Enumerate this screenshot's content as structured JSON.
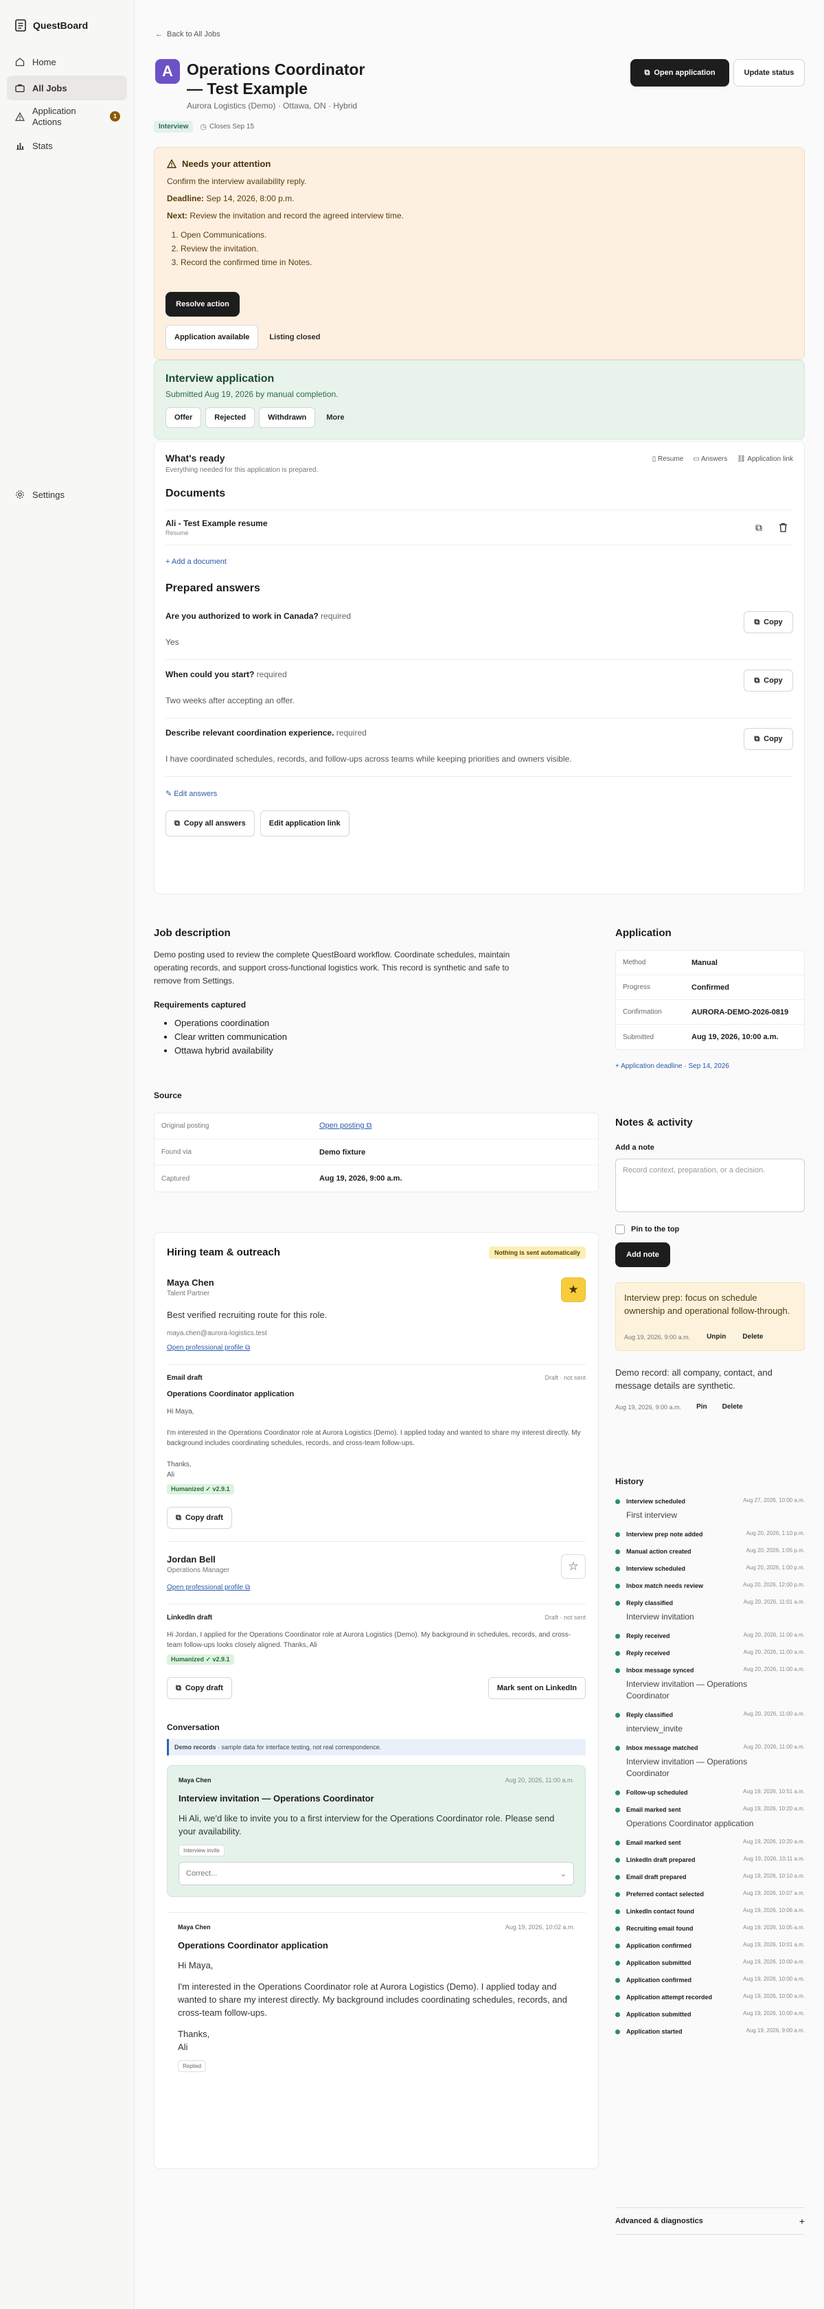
{
  "app": {
    "name": "QuestBoard"
  },
  "sidebar": {
    "items": [
      {
        "label": "Home",
        "icon": "home-icon"
      },
      {
        "label": "All Jobs",
        "icon": "briefcase-icon"
      },
      {
        "label": "Application Actions",
        "icon": "alert-icon",
        "badge": "1"
      },
      {
        "label": "Stats",
        "icon": "bar-chart-icon"
      }
    ],
    "settings": "Settings"
  },
  "header": {
    "back": "Back to All Jobs",
    "logo_letter": "A",
    "title": "Operations Coordinator — Test Example",
    "company": "Aurora Logistics (Demo) · Ottawa, ON · Hybrid",
    "stage": "Interview",
    "closes": "Closes Sep 15",
    "open_button": "Open application",
    "status_button": "Update status"
  },
  "attention": {
    "title": "Needs your attention",
    "line1": "Confirm the interview availability reply.",
    "deadline_label": "Deadline:",
    "deadline": "Sep 14, 2026, 8:00 p.m.",
    "next_label": "Next:",
    "next": "Review the invitation and record the agreed interview time.",
    "steps": [
      "Open Communications.",
      "Review the invitation.",
      "Record the confirmed time in Notes."
    ],
    "resolve": "Resolve action",
    "tag1": "Application available",
    "tag2": "Listing closed"
  },
  "interview_app": {
    "title": "Interview application",
    "subtitle": "Submitted Aug 19, 2026 by manual completion.",
    "actions": [
      "Offer",
      "Rejected",
      "Withdrawn",
      "More"
    ]
  },
  "ready": {
    "title": "What's ready",
    "subtitle": "Everything needed for this application is prepared.",
    "links": [
      "Resume",
      "Answers",
      "Application link"
    ],
    "documents_title": "Documents",
    "document": {
      "name": "Ali - Test Example resume",
      "kind": "Resume"
    },
    "add_document": "+ Add a document",
    "answers_title": "Prepared answers",
    "questions": [
      {
        "q": "Are you authorized to work in Canada?",
        "req": "required",
        "a": "Yes"
      },
      {
        "q": "When could you start?",
        "req": "required",
        "a": "Two weeks after accepting an offer."
      },
      {
        "q": "Describe relevant coordination experience.",
        "req": "required",
        "a": "I have coordinated schedules, records, and follow-ups across teams while keeping priorities and owners visible."
      }
    ],
    "copy": "Copy",
    "edit_answers": "✎ Edit answers",
    "copy_all": "Copy all answers",
    "edit_link": "Edit application link"
  },
  "job": {
    "title": "Job description",
    "text": "Demo posting used to review the complete QuestBoard workflow. Coordinate schedules, maintain operating records, and support cross-functional logistics work. This record is synthetic and safe to remove from Settings.",
    "req_title": "Requirements captured",
    "reqs": [
      "Operations coordination",
      "Clear written communication",
      "Ottawa hybrid availability"
    ]
  },
  "source": {
    "title": "Source",
    "rows": [
      {
        "k": "Original posting",
        "v": "Open posting"
      },
      {
        "k": "Found via",
        "v": "Demo fixture"
      },
      {
        "k": "Captured",
        "v": "Aug 19, 2026, 9:00 a.m."
      }
    ]
  },
  "application": {
    "title": "Application",
    "rows": [
      {
        "k": "Method",
        "v": "Manual"
      },
      {
        "k": "Progress",
        "v": "Confirmed"
      },
      {
        "k": "Confirmation",
        "v": "AURORA-DEMO-2026-0819"
      },
      {
        "k": "Submitted",
        "v": "Aug 19, 2026, 10:00 a.m."
      }
    ],
    "deadline_link": "+ Application deadline · Sep 14, 2026"
  },
  "hiring": {
    "title": "Hiring team & outreach",
    "badge": "Nothing is sent automatically",
    "contact1": {
      "name": "Maya Chen",
      "role": "Talent Partner",
      "note": "Best verified recruiting route for this role.",
      "email": "maya.chen@aurora-logistics.test",
      "profile": "Open professional profile"
    },
    "email_draft": {
      "label": "Email draft",
      "status": "Draft · not sent",
      "subject": "Operations Coordinator application",
      "greeting": "Hi Maya,",
      "body": "I'm interested in the Operations Coordinator role at Aurora Logistics (Demo). I applied today and wanted to share my interest directly. My background includes coordinating schedules, records, and cross-team follow-ups.",
      "signoff": "Thanks,",
      "name": "Ali",
      "humanized": "Humanized ✓ v2.9.1",
      "copy": "Copy draft"
    },
    "contact2": {
      "name": "Jordan Bell",
      "role": "Operations Manager",
      "profile": "Open professional profile"
    },
    "linkedin_draft": {
      "label": "LinkedIn draft",
      "status": "Draft · not sent",
      "body": "Hi Jordan, I applied for the Operations Coordinator role at Aurora Logistics (Demo). My background in schedules, records, and cross-team follow-ups looks closely aligned. Thanks, Ali",
      "humanized": "Humanized ✓ v2.9.1",
      "copy": "Copy draft",
      "mark": "Mark sent on LinkedIn"
    },
    "conversation": {
      "title": "Conversation",
      "demo_label": "Demo records",
      "demo_text": " · sample data for interface testing, not real correspondence.",
      "msg1": {
        "from": "Maya Chen",
        "time": "Aug 20, 2026, 11:00 a.m.",
        "subject": "Interview invitation — Operations Coordinator",
        "body": "Hi Ali, we'd like to invite you to a first interview for the Operations Coordinator role. Please send your availability.",
        "tag": "Interview invite",
        "select": "Correct..."
      },
      "msg2": {
        "from": "Operations Coordinator application",
        "sender": "Maya Chen",
        "time": "Aug 19, 2026, 10:02 a.m.",
        "greeting": "Hi Maya,",
        "body": "I'm interested in the Operations Coordinator role at Aurora Logistics (Demo). I applied today and wanted to share my interest directly. My background includes coordinating schedules, records, and cross-team follow-ups.",
        "signoff": "Thanks,",
        "name": "Ali",
        "tag": "Replied"
      }
    }
  },
  "notes": {
    "title": "Notes & activity",
    "add_label": "Add a note",
    "placeholder": "Record context, preparation, or a decision.",
    "pin_label": "Pin to the top",
    "add_button": "Add note",
    "pinned": {
      "text": "Interview prep: focus on schedule ownership and operational follow-through.",
      "time": "Aug 19, 2026, 9:00 a.m.",
      "unpin": "Unpin",
      "delete": "Delete"
    },
    "record": {
      "text": "Demo record: all company, contact, and message details are synthetic.",
      "time": "Aug 19, 2026, 9:00 a.m.",
      "pin": "Pin",
      "delete": "Delete"
    }
  },
  "history": {
    "title": "History",
    "items": [
      {
        "e": "Interview scheduled",
        "t": "Aug 27, 2026, 10:00 a.m.",
        "s": "First interview"
      },
      {
        "e": "Interview prep note added",
        "t": "Aug 20, 2026, 1:10 p.m.",
        "s": ""
      },
      {
        "e": "Manual action created",
        "t": "Aug 20, 2026, 1:05 p.m.",
        "s": ""
      },
      {
        "e": "Interview scheduled",
        "t": "Aug 20, 2026, 1:00 p.m.",
        "s": ""
      },
      {
        "e": "Inbox match needs review",
        "t": "Aug 20, 2026, 12:00 p.m.",
        "s": ""
      },
      {
        "e": "Reply classified",
        "t": "Aug 20, 2026, 11:01 a.m.",
        "s": "Interview invitation"
      },
      {
        "e": "Reply received",
        "t": "Aug 20, 2026, 11:00 a.m.",
        "s": ""
      },
      {
        "e": "Reply received",
        "t": "Aug 20, 2026, 11:00 a.m.",
        "s": ""
      },
      {
        "e": "Inbox message synced",
        "t": "Aug 20, 2026, 11:00 a.m.",
        "s": "Interview invitation — Operations Coordinator"
      },
      {
        "e": "Reply classified",
        "t": "Aug 20, 2026, 11:00 a.m.",
        "s": "interview_invite"
      },
      {
        "e": "Inbox message matched",
        "t": "Aug 20, 2026, 11:00 a.m.",
        "s": "Interview invitation — Operations Coordinator"
      },
      {
        "e": "Follow-up scheduled",
        "t": "Aug 19, 2026, 10:51 a.m.",
        "s": ""
      },
      {
        "e": "Email marked sent",
        "t": "Aug 19, 2026, 10:20 a.m.",
        "s": "Operations Coordinator application"
      },
      {
        "e": "Email marked sent",
        "t": "Aug 19, 2026, 10:20 a.m.",
        "s": ""
      },
      {
        "e": "LinkedIn draft prepared",
        "t": "Aug 19, 2026, 10:11 a.m.",
        "s": ""
      },
      {
        "e": "Email draft prepared",
        "t": "Aug 19, 2026, 10:10 a.m.",
        "s": ""
      },
      {
        "e": "Preferred contact selected",
        "t": "Aug 19, 2026, 10:07 a.m.",
        "s": ""
      },
      {
        "e": "LinkedIn contact found",
        "t": "Aug 19, 2026, 10:06 a.m.",
        "s": ""
      },
      {
        "e": "Recruiting email found",
        "t": "Aug 19, 2026, 10:05 a.m.",
        "s": ""
      },
      {
        "e": "Application confirmed",
        "t": "Aug 19, 2026, 10:01 a.m.",
        "s": ""
      },
      {
        "e": "Application submitted",
        "t": "Aug 19, 2026, 10:00 a.m.",
        "s": ""
      },
      {
        "e": "Application confirmed",
        "t": "Aug 19, 2026, 10:00 a.m.",
        "s": ""
      },
      {
        "e": "Application attempt recorded",
        "t": "Aug 19, 2026, 10:00 a.m.",
        "s": ""
      },
      {
        "e": "Application submitted",
        "t": "Aug 19, 2026, 10:00 a.m.",
        "s": ""
      },
      {
        "e": "Application started",
        "t": "Aug 19, 2026, 9:00 a.m.",
        "s": ""
      }
    ]
  },
  "advanced": {
    "label": "Advanced & diagnostics",
    "icon": "+"
  },
  "colors": {
    "accent": "#6d52c7",
    "attention_bg": "#fdf0e0",
    "success_bg": "#e8f3ec",
    "dark": "#1d1d1d"
  }
}
